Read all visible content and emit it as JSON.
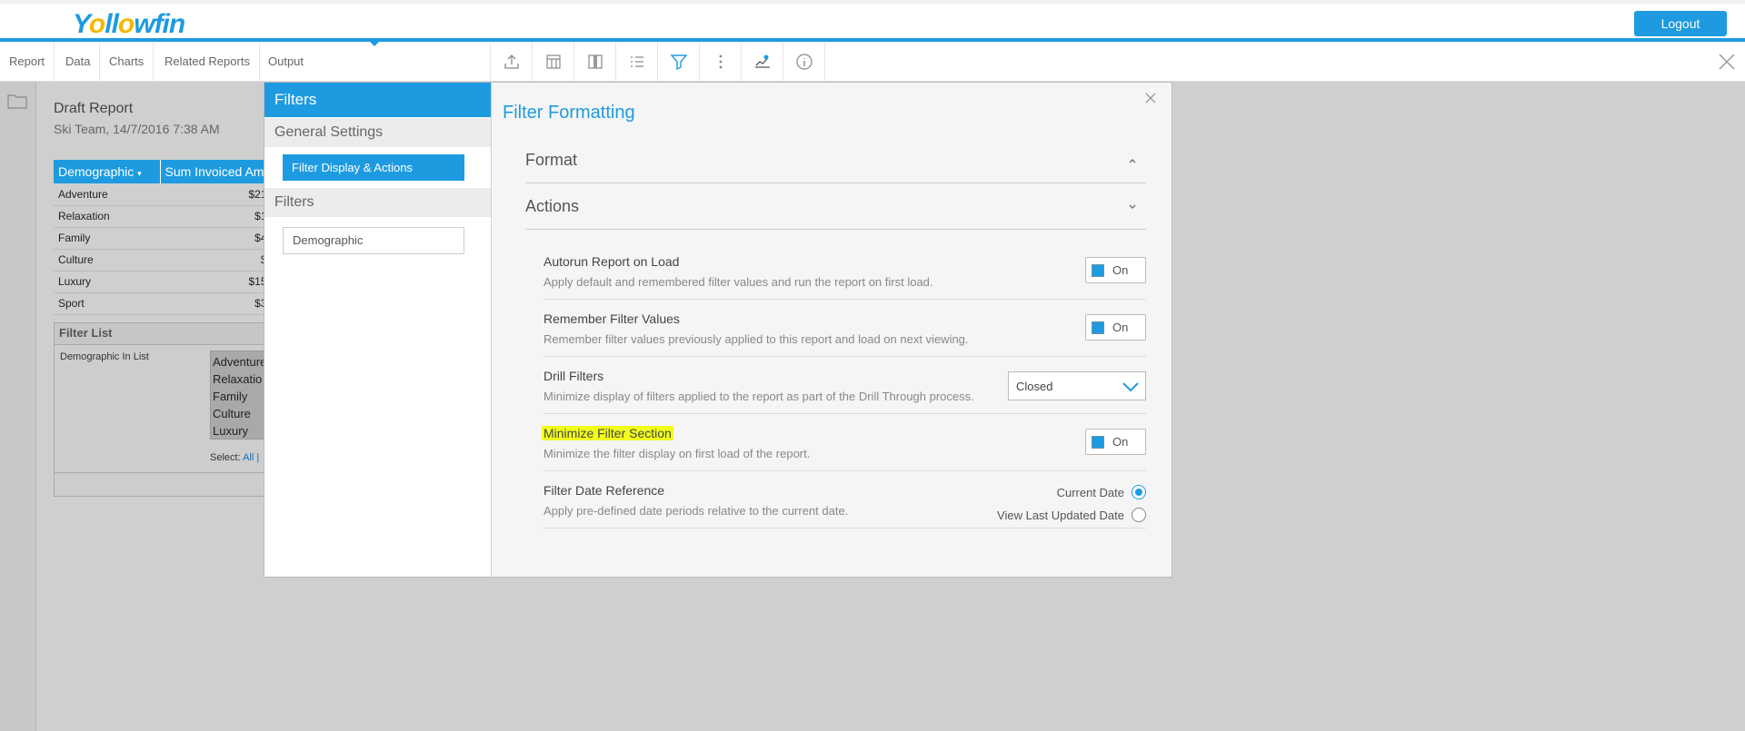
{
  "header": {
    "logo_part1": "Y",
    "logo_part2": "ll",
    "logo_part3": "wfin",
    "logout_label": "Logout"
  },
  "nav": {
    "tabs": [
      "Report",
      "Data",
      "Charts",
      "Related Reports",
      "Output"
    ],
    "active_tab": "Output"
  },
  "toolbar": {
    "icons": [
      "export-icon",
      "table-icon",
      "columns-icon",
      "list-icon",
      "filter-icon",
      "more-vertical-icon",
      "chart-settings-icon",
      "info-icon"
    ]
  },
  "report": {
    "title": "Draft Report",
    "subtitle": "Ski Team, 14/7/2016 7:38 AM",
    "columns": [
      "Demographic",
      "Sum Invoiced Am"
    ],
    "rows": [
      {
        "name": "Adventure",
        "value": "$21"
      },
      {
        "name": "Relaxation",
        "value": "$1"
      },
      {
        "name": "Family",
        "value": "$4"
      },
      {
        "name": "Culture",
        "value": "$"
      },
      {
        "name": "Luxury",
        "value": "$15"
      },
      {
        "name": "Sport",
        "value": "$3"
      }
    ],
    "filter_list": {
      "title": "Filter List",
      "label": "Demographic In List",
      "options": [
        "Adventure",
        "Relaxatio",
        "Family",
        "Culture",
        "Luxury"
      ],
      "select_label": "Select:",
      "select_all": "All",
      "select_sep": "|"
    }
  },
  "modal": {
    "sidebar": {
      "title": "Filters",
      "section_general": "General Settings",
      "active_item": "Filter Display & Actions",
      "section_filters": "Filters",
      "filter_item": "Demographic"
    },
    "title": "Filter Formatting",
    "accordion": {
      "format": "Format",
      "actions": "Actions"
    },
    "settings": [
      {
        "title": "Autorun Report on Load",
        "desc": "Apply default and remembered filter values and run the report on first load.",
        "control": "On"
      },
      {
        "title": "Remember Filter Values",
        "desc": "Remember filter values previously applied to this report and load on next viewing.",
        "control": "On"
      },
      {
        "title": "Drill Filters",
        "desc": "Minimize display of filters applied to the report as part of the Drill Through process.",
        "control": "Closed"
      },
      {
        "title": "Minimize Filter Section",
        "desc": "Minimize the filter display on first load of the report.",
        "control": "On"
      },
      {
        "title": "Filter Date Reference",
        "desc": "Apply pre-defined date periods relative to the current date.",
        "option1": "Current Date",
        "option2": "View Last Updated Date",
        "selected": "Current Date"
      }
    ]
  },
  "colors": {
    "accent": "#1e9be0",
    "highlight": "#f2ff1a",
    "logo_o": "#f4b800"
  }
}
